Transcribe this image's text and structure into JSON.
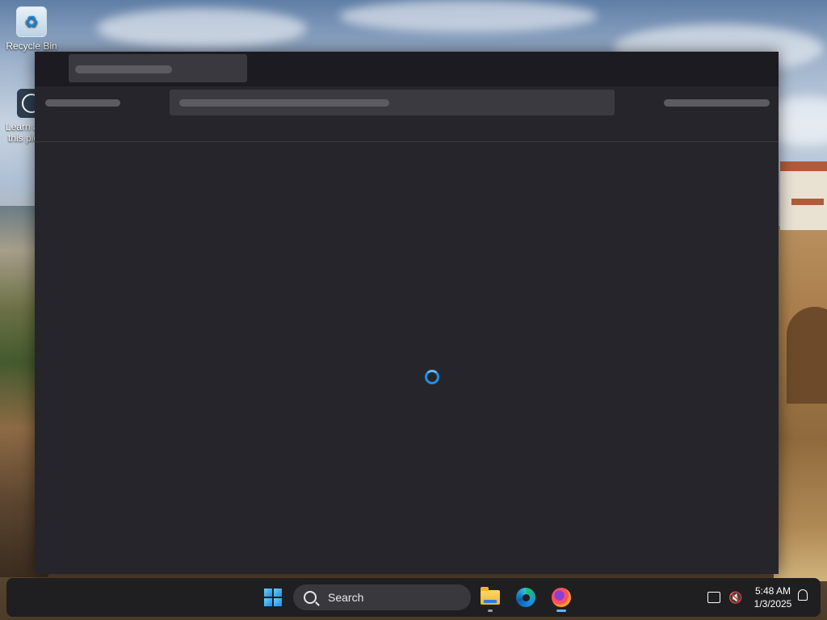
{
  "desktop": {
    "icons": [
      {
        "label": "Recycle Bin",
        "icon": "recycle-bin-icon"
      },
      {
        "label": "Learn about this picture",
        "icon": "learn-about-picture-icon"
      }
    ]
  },
  "browser": {
    "state": "loading",
    "tab_title": "",
    "address": "",
    "toolbar_left": "",
    "toolbar_right": ""
  },
  "taskbar": {
    "start_icon": "windows-start-icon",
    "search_label": "Search",
    "pinned": [
      {
        "name": "File Explorer",
        "icon": "file-explorer-icon",
        "running": true
      },
      {
        "name": "Microsoft Edge",
        "icon": "edge-icon",
        "running": false
      },
      {
        "name": "Firefox",
        "icon": "firefox-icon",
        "running": true
      }
    ],
    "tray": {
      "network_icon": "network-icon",
      "volume_icon": "volume-muted-icon",
      "time": "5:48 AM",
      "date": "1/3/2025",
      "notification_icon": "bell-icon"
    }
  },
  "colors": {
    "window_bg": "#252429",
    "titlebar_bg": "#1c1b21",
    "taskbar_bg": "#1f1f22",
    "spinner": "#1e90e8"
  }
}
